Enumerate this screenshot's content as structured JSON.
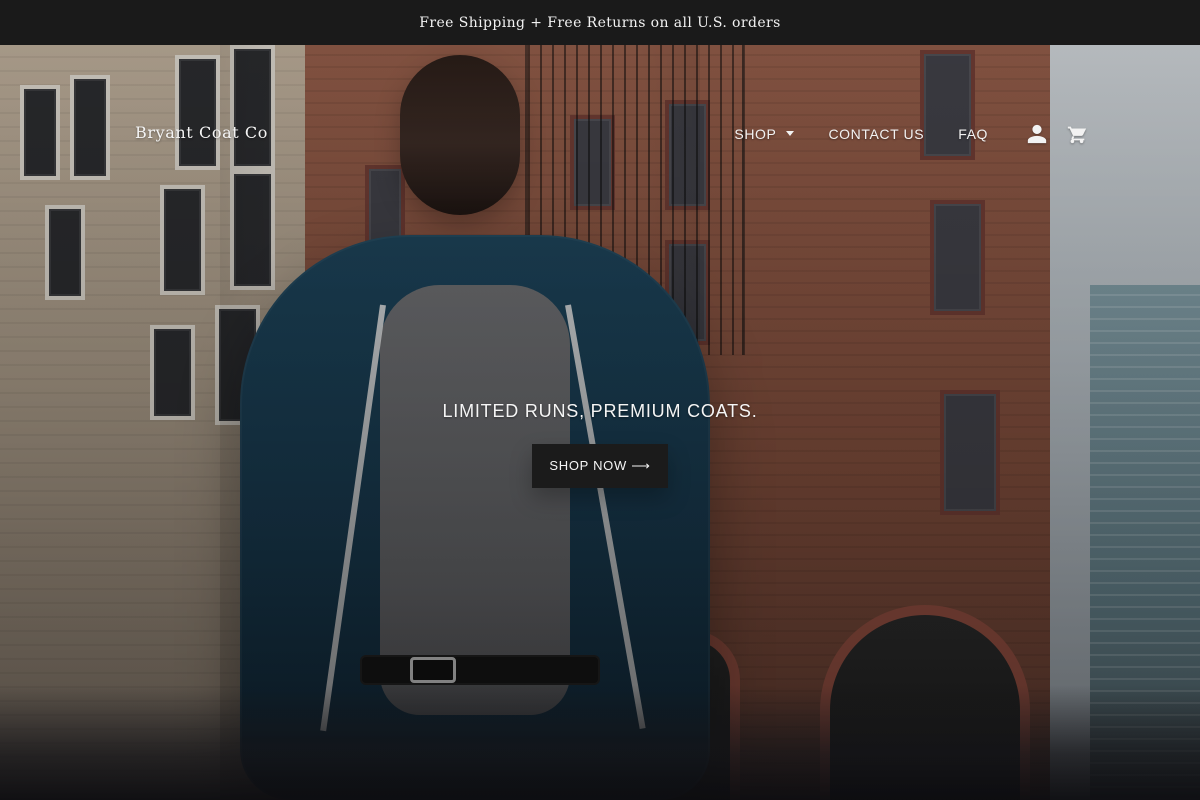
{
  "announcement": {
    "text": "Free Shipping + Free Returns on all U.S. orders"
  },
  "header": {
    "brand": "Bryant Coat Co",
    "nav": [
      {
        "label": "SHOP",
        "has_dropdown": true
      },
      {
        "label": "CONTACT US",
        "has_dropdown": false
      },
      {
        "label": "FAQ",
        "has_dropdown": false
      }
    ],
    "icons": [
      {
        "name": "account-icon"
      },
      {
        "name": "cart-icon"
      }
    ]
  },
  "hero": {
    "headline": "LIMITED RUNS, PREMIUM COATS.",
    "cta_label": "SHOP NOW ⟶",
    "carousel": {
      "count": 3,
      "active_index": 0
    }
  }
}
